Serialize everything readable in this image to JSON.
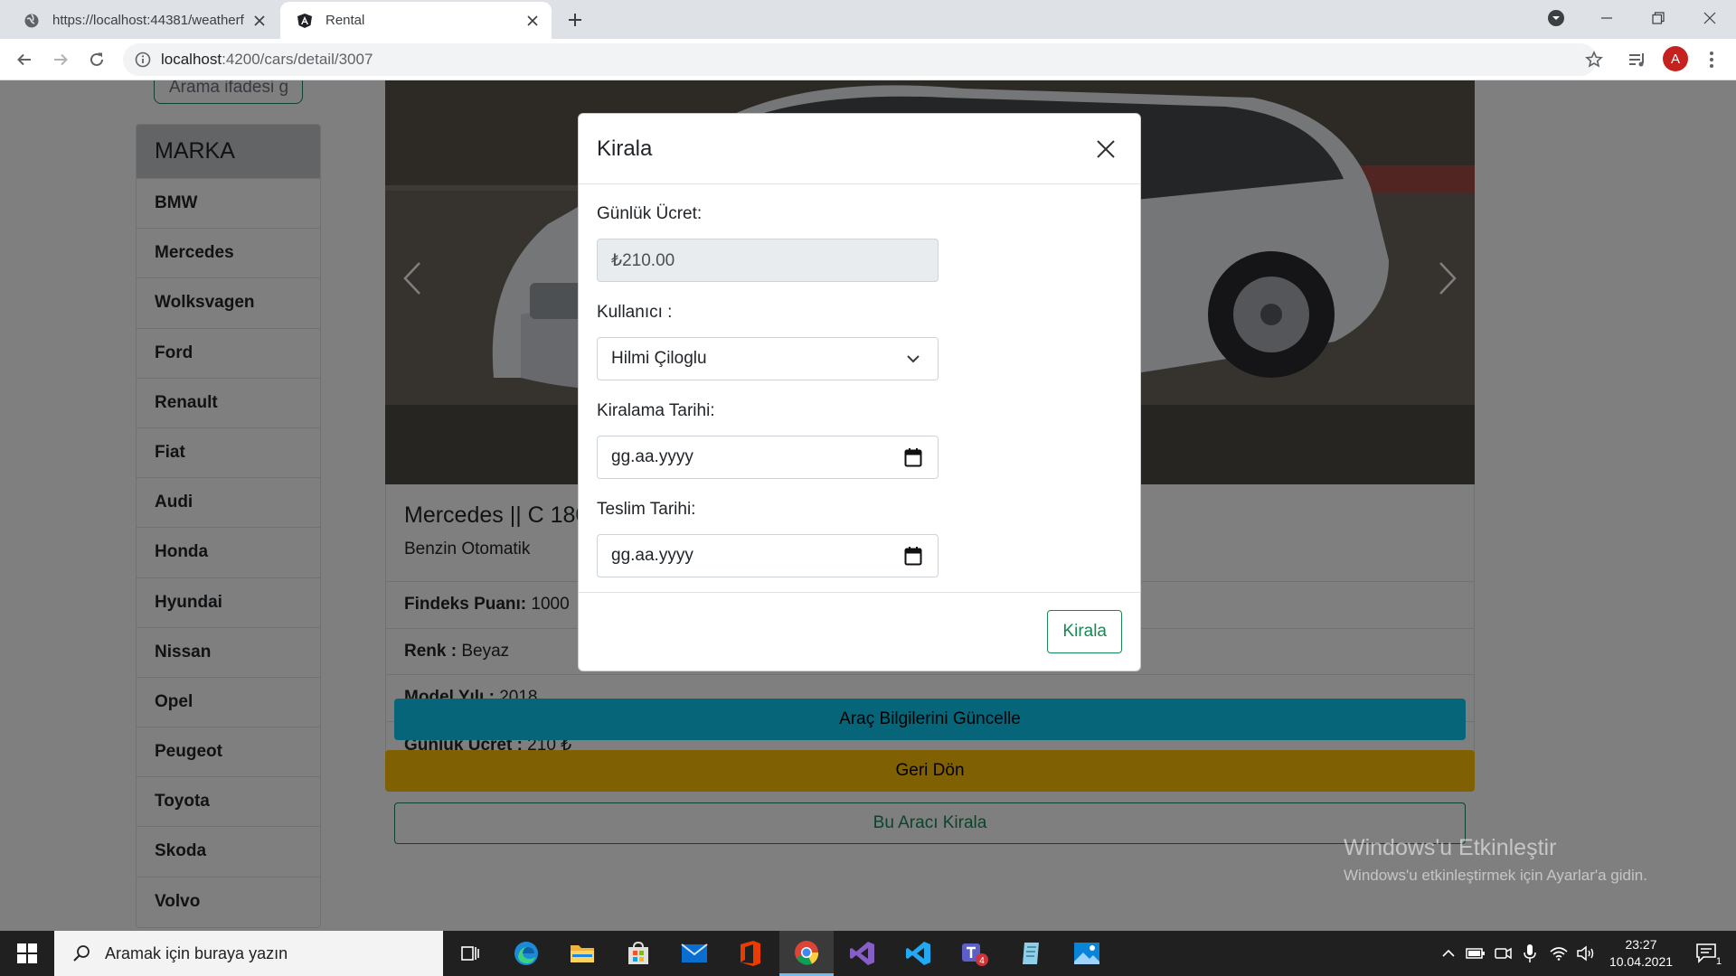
{
  "browser": {
    "tabs": [
      {
        "title": "https://localhost:44381/weatherf",
        "icon": "globe-icon",
        "active": false
      },
      {
        "title": "Rental",
        "icon": "angular-icon",
        "active": true
      }
    ],
    "url_host": "localhost",
    "url_path": ":4200/cars/detail/3007",
    "profile_initial": "A"
  },
  "page": {
    "search_placeholder": "Arama ifadesi g",
    "brands_header": "MARKA",
    "brands": [
      "BMW",
      "Mercedes",
      "Wolksvagen",
      "Ford",
      "Renault",
      "Fiat",
      "Audi",
      "Honda",
      "Hyundai",
      "Nissan",
      "Opel",
      "Peugeot",
      "Toyota",
      "Skoda",
      "Volvo"
    ],
    "car": {
      "title": "Mercedes || C 180",
      "subtitle": "Benzin Otomatik",
      "rows": [
        {
          "label": "Findeks Puanı:",
          "value": " 1000"
        },
        {
          "label": "Renk :",
          "value": " Beyaz"
        },
        {
          "label": "Model Yılı :",
          "value": " 2018"
        },
        {
          "label": "Günlük Ücret :",
          "value": " 210 ₺"
        }
      ]
    },
    "buttons": {
      "update": "Araç Bilgilerini Güncelle",
      "back": "Geri Dön",
      "rent_car": "Bu Aracı Kirala"
    }
  },
  "modal": {
    "title": "Kirala",
    "daily_fee_label": "Günlük Ücret:",
    "daily_fee_value": "₺210.00",
    "user_label": "Kullanıcı :",
    "user_value": "Hilmi Çiloglu",
    "rent_date_label": "Kiralama Tarihi:",
    "rent_date_placeholder": "gg.aa.yyyy",
    "return_date_label": "Teslim Tarihi:",
    "return_date_placeholder": "gg.aa.yyyy",
    "submit_label": "Kirala"
  },
  "watermark": {
    "title": "Windows'u Etkinleştir",
    "subtitle": "Windows'u etkinleştirmek için Ayarlar'a gidin."
  },
  "taskbar": {
    "search_placeholder": "Aramak için buraya yazın",
    "time": "23:27",
    "date": "10.04.2021",
    "notification_count": "1",
    "teams_badge": "4"
  },
  "colors": {
    "success": "#198754",
    "info": "#0dcaf0",
    "warning": "#ffc107",
    "taskbar": "#202020"
  }
}
